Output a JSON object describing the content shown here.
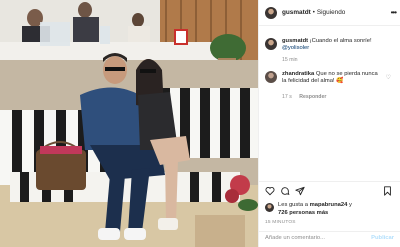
{
  "post": {
    "author": "gusmatdt",
    "separator": "•",
    "follow_label": "Siguiendo",
    "more_icon": "ellipsis-icon",
    "comments": [
      {
        "user": "gusmatdt",
        "text": "¡Cuando el alma sonríe!",
        "mention": "@yolisoler",
        "time": "15 min"
      },
      {
        "user": "zhandratika",
        "text": "Que no se pierda nunca la felicidad del alma!",
        "emoji": "🥰",
        "time": "17 s",
        "reply_label": "Responder"
      }
    ],
    "actions": [
      "heart-icon",
      "comment-icon",
      "share-icon",
      "bookmark-icon"
    ],
    "likes": {
      "prefix": "Les gusta a",
      "liker": "mapabruna24",
      "conjunction": "y",
      "count_text": "726 personas más"
    },
    "timestamp": "15 MINUTOS",
    "add_comment_placeholder": "Añade un comentario...",
    "publish_label": "Publicar",
    "colors": {
      "link": "#00376b",
      "publish_disabled": "#b2dffc",
      "muted": "#8e8e8e"
    }
  }
}
